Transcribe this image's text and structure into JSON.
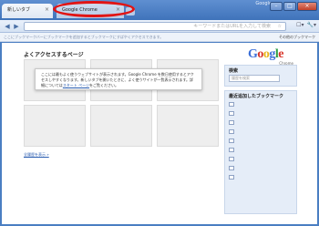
{
  "tabs": [
    {
      "label": "新しいタブ",
      "close": "×"
    },
    {
      "label": "Google Chrome",
      "close": "×"
    }
  ],
  "window": {
    "brand": "Google",
    "minimize": "–",
    "maximize": "□",
    "close": "×"
  },
  "toolbar": {
    "back": "◀",
    "forward": "▶",
    "omnibox_hint": "キーワードまたはURLを入力して検索",
    "star": "☆",
    "page_menu": "☐▾",
    "tools_menu": "🔧▾"
  },
  "bookmarkbar": {
    "hint": "ここにブックマークバーにブックマークを追加するとブックマークにすばやくアクセスできます。",
    "other": "その他のブックマーク"
  },
  "main": {
    "section_title": "よくアクセスするページ",
    "info_text": "ここには最もよく使うウェブサイトが表示されます。Google Chrome を数日使用するとアクセスしやすくなります。新しいタブを開いたときに、よく使うサイトが一覧表示されます。詳細については",
    "info_link": "スタート ページ",
    "info_tail": "をご覧ください。",
    "more_link": "全履歴を表示 »"
  },
  "sidebar": {
    "logo_letters": [
      "G",
      "o",
      "o",
      "g",
      "l",
      "e"
    ],
    "logo_sub": "Chrome",
    "search_title": "検索",
    "search_placeholder": "履歴を検索",
    "recent_bookmarks_title": "最近追加したブックマーク"
  },
  "colors": {
    "accent": "#e11414",
    "chrome_blue": "#4a7ec2"
  }
}
